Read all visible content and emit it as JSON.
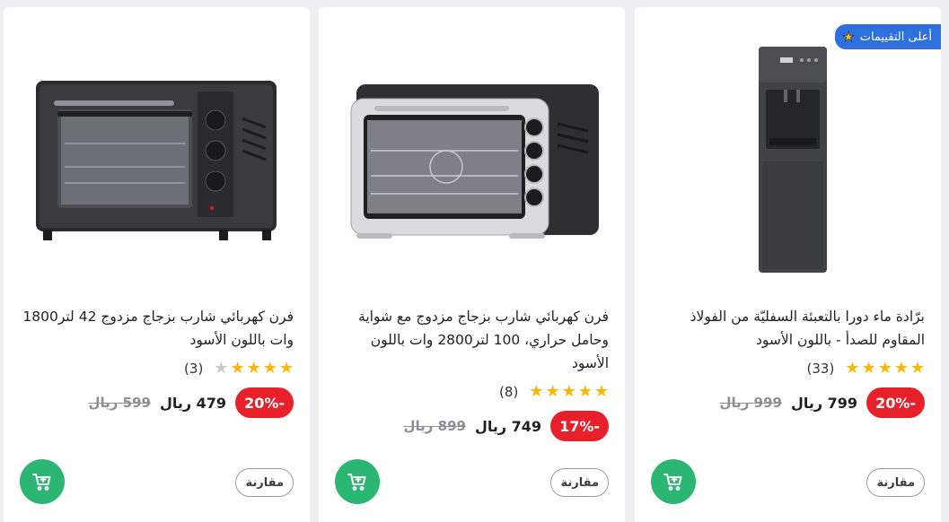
{
  "products": [
    {
      "title": "فرن كهربائي شارب بزجاج مزدوج 42 لتر1800 وات باللون الأسود",
      "stars_filled": 4,
      "review_count": "(3)",
      "discount": "-20%",
      "price_now": "479 ريال",
      "price_was": "599 ريال",
      "compare_label": "مقارنة",
      "image_icon": "black-oven-image"
    },
    {
      "title": "فرن كهربائي شارب بزجاج مزدوج مع شواية وحامل حراري، 100 لتر2800 وات باللون الأسود",
      "stars_filled": 5,
      "review_count": "(8)",
      "discount": "-17%",
      "price_now": "749 ريال",
      "price_was": "899 ريال",
      "compare_label": "مقارنة",
      "image_icon": "silver-oven-image"
    },
    {
      "badge": "أعلى التقييمات",
      "title": "برّادة ماء دورا بالتعبئة السفليّة من الفولاذ المقاوم للصدأ - باللون الأسود",
      "stars_filled": 5,
      "review_count": "(33)",
      "discount": "-20%",
      "price_now": "799 ريال",
      "price_was": "999 ريال",
      "compare_label": "مقارنة",
      "image_icon": "water-dispenser-image"
    }
  ],
  "colors": {
    "badge": "#2f6fe0",
    "discount": "#e8202a",
    "cart": "#2bb673",
    "star": "#f9b60c"
  },
  "icons": {
    "cart": "add-to-cart-icon",
    "star": "star-icon",
    "badge_star": "star-icon"
  }
}
